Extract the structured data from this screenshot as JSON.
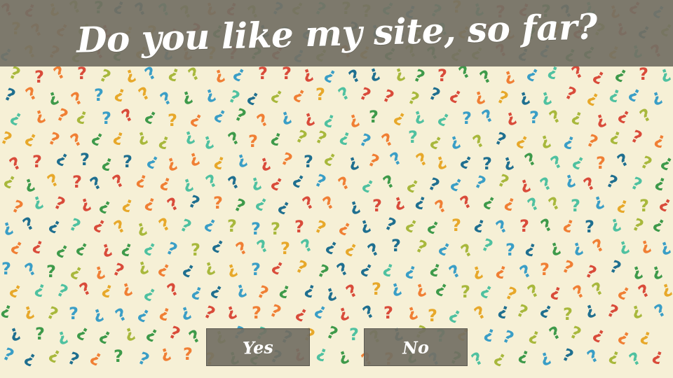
{
  "page": {
    "title": "Do you like my site, so far?"
  },
  "buttons": {
    "yes_label": "Yes",
    "no_label": "No"
  },
  "background": {
    "pattern_glyph": "?",
    "color": "#f6f0d6",
    "glyph_colors": [
      "#d94b3a",
      "#f07f34",
      "#e7a82a",
      "#a8b83c",
      "#3e9a4a",
      "#4fc1a0",
      "#3a9ec6",
      "#1f6f8f"
    ]
  },
  "theme": {
    "overlay_color": "#737064",
    "text_color": "#ffffff"
  }
}
